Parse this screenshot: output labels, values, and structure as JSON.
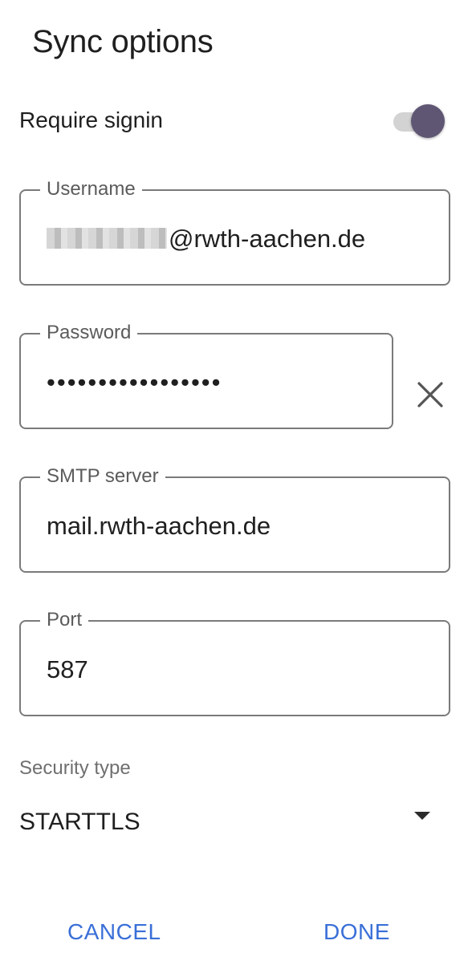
{
  "dialog": {
    "title": "Sync options"
  },
  "require_signin": {
    "label": "Require signin",
    "enabled": true
  },
  "fields": {
    "username": {
      "label": "Username",
      "value_suffix": "@rwth-aachen.de"
    },
    "password": {
      "label": "Password",
      "value": "•••••••••••••••••"
    },
    "smtp": {
      "label": "SMTP server",
      "value": "mail.rwth-aachen.de"
    },
    "port": {
      "label": "Port",
      "value": "587"
    }
  },
  "security": {
    "label": "Security type",
    "selected": "STARTTLS"
  },
  "actions": {
    "cancel": "CANCEL",
    "done": "DONE"
  },
  "colors": {
    "accent": "#3a6fd8",
    "switch_thumb": "#5e5673",
    "switch_track": "#d3d3d3",
    "border": "#7a7a7a"
  },
  "icons": {
    "clear": "close-icon",
    "dropdown": "caret-down-icon"
  }
}
